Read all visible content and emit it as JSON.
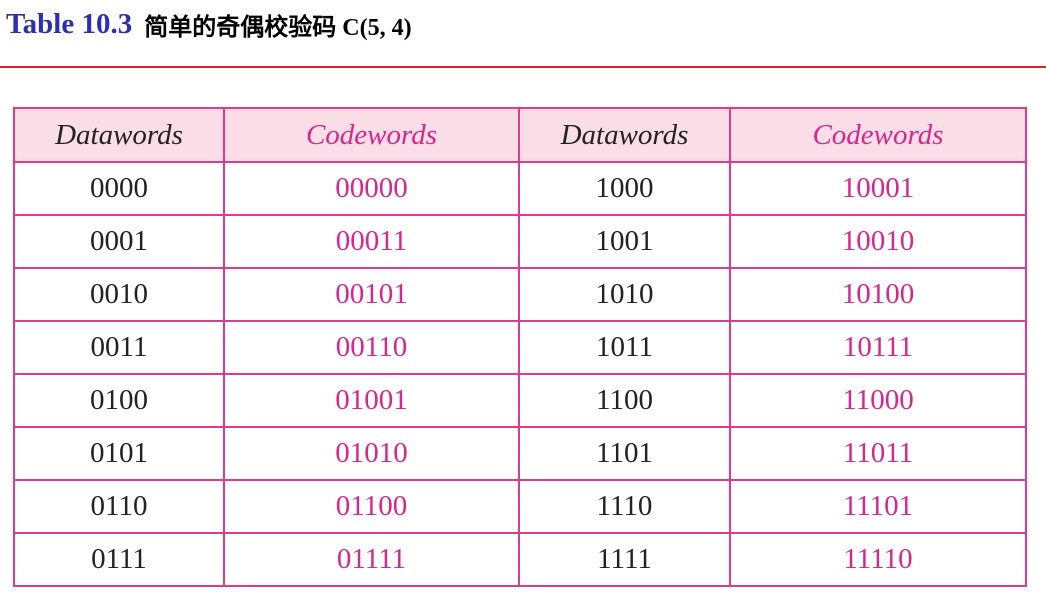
{
  "title": {
    "label": "Table 10.3",
    "text": "简单的奇偶校验码 C(5, 4)"
  },
  "table": {
    "headers": [
      "Datawords",
      "Codewords",
      "Datawords",
      "Codewords"
    ],
    "rows": [
      [
        "0000",
        "00000",
        "1000",
        "10001"
      ],
      [
        "0001",
        "00011",
        "1001",
        "10010"
      ],
      [
        "0010",
        "00101",
        "1010",
        "10100"
      ],
      [
        "0011",
        "00110",
        "1011",
        "10111"
      ],
      [
        "0100",
        "01001",
        "1100",
        "11000"
      ],
      [
        "0101",
        "01010",
        "1101",
        "11011"
      ],
      [
        "0110",
        "01100",
        "1110",
        "11101"
      ],
      [
        "0111",
        "01111",
        "1111",
        "11110"
      ]
    ]
  },
  "colors": {
    "title_label": "#2e2fb0",
    "rule": "#d9262c",
    "border": "#e03a8c",
    "header_bg": "#fbdde8",
    "codeword_text": "#d6278a"
  }
}
